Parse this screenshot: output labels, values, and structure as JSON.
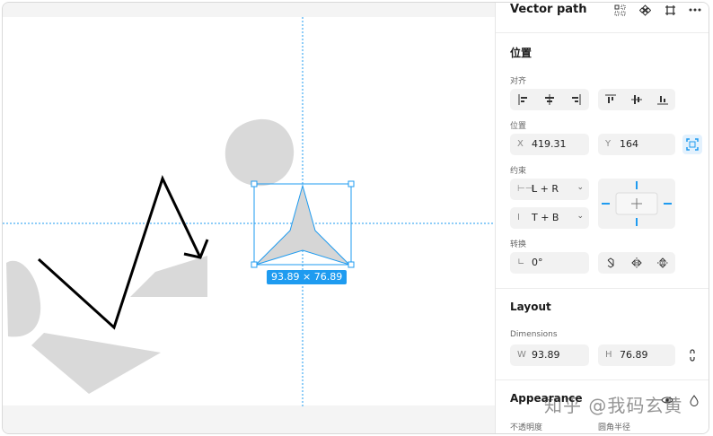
{
  "canvas": {
    "selection_size": "93.89 × 76.89"
  },
  "panel": {
    "title": "Vector path",
    "header_icons": [
      "component-grid-icon",
      "diamond-components-icon",
      "frame-crop-icon",
      "more-horizontal-icon"
    ],
    "position_section": {
      "title": "位置",
      "align_label": "对齐",
      "position_label": "位置",
      "x_prefix": "X",
      "x_value": "419.31",
      "y_prefix": "Y",
      "y_value": "164",
      "constraints_label": "约束",
      "constraint_h": "L + R",
      "constraint_v": "T + B",
      "transform_label": "转换",
      "rotation": "0°"
    },
    "layout_section": {
      "title": "Layout",
      "dimensions_label": "Dimensions",
      "w_prefix": "W",
      "w_value": "93.89",
      "h_prefix": "H",
      "h_value": "76.89"
    },
    "appearance_section": {
      "title": "Appearance",
      "opacity_label": "不透明度",
      "radius_label": "圆角半径"
    }
  },
  "watermark": "知乎 @我码玄黄",
  "colors": {
    "accent": "#1e9bf0",
    "shape_gray": "#d9d9d9",
    "guide": "#1e9bf0"
  }
}
